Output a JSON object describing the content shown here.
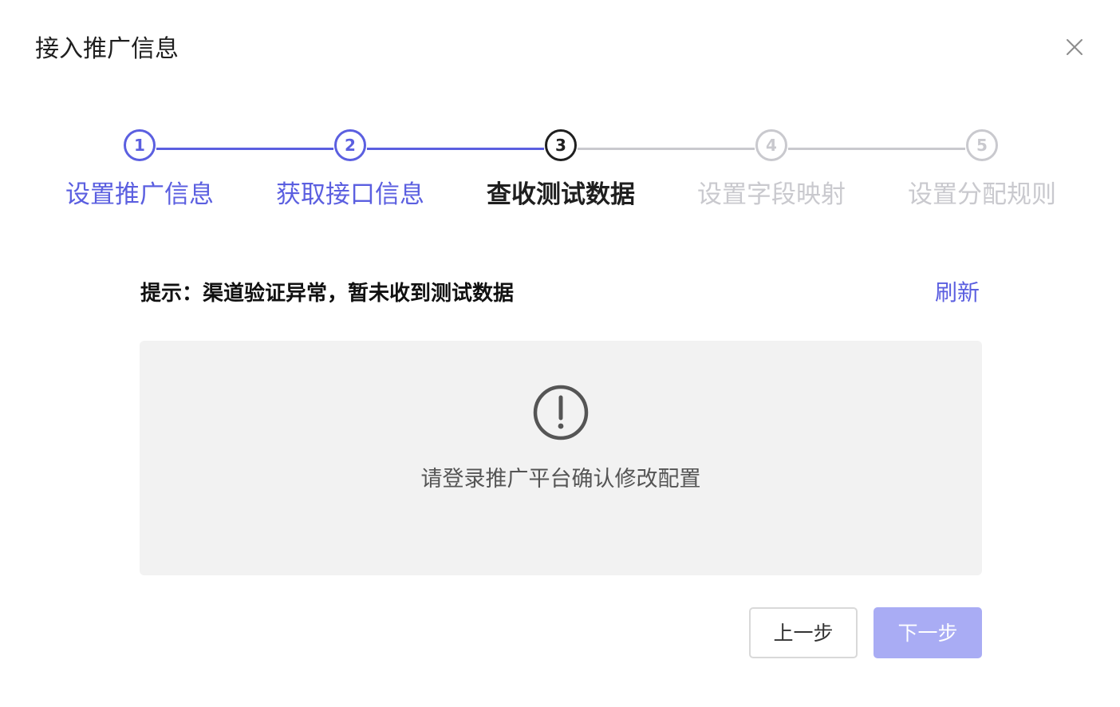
{
  "dialog": {
    "title": "接入推广信息",
    "close_icon": "close-icon"
  },
  "steps": [
    {
      "number": "1",
      "label": "设置推广信息",
      "state": "done"
    },
    {
      "number": "2",
      "label": "获取接口信息",
      "state": "done"
    },
    {
      "number": "3",
      "label": "查收测试数据",
      "state": "active"
    },
    {
      "number": "4",
      "label": "设置字段映射",
      "state": "pending"
    },
    {
      "number": "5",
      "label": "设置分配规则",
      "state": "pending"
    }
  ],
  "tip": {
    "text": "提示：渠道验证异常，暂未收到测试数据",
    "refresh_label": "刷新"
  },
  "status": {
    "icon": "warning-circle-icon",
    "message": "请登录推广平台确认修改配置"
  },
  "footer": {
    "prev_label": "上一步",
    "next_label": "下一步"
  },
  "colors": {
    "primary": "#5b5fe0",
    "primary_disabled": "#a9acf4",
    "inactive": "#c9c9ce",
    "panel_bg": "#f2f2f2"
  }
}
